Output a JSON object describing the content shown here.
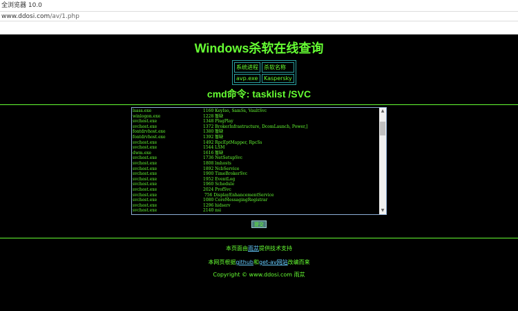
{
  "browser": {
    "title": "全浏览器 10.0",
    "url_host": "www.ddosi.com",
    "url_path": "/av/1.php"
  },
  "page": {
    "title": "Windows杀软在线查询",
    "table_headers": [
      "系统进程",
      "杀软名称"
    ],
    "table_rows": [
      [
        "avp.exe",
        "Kaspersky"
      ]
    ],
    "cmd_label": "cmd命令: tasklist /SVC",
    "processes": [
      {
        "image": "lsass.exe",
        "pid": "1160",
        "svc": "KeyIso, SamSs, VaultSvc"
      },
      {
        "image": "winlogon.exe",
        "pid": "1228",
        "svc": "暂缺"
      },
      {
        "image": "svchost.exe",
        "pid": "1348",
        "svc": "PlugPlay"
      },
      {
        "image": "svchost.exe",
        "pid": "1372",
        "svc": "BrokerInfrastructure, DcomLaunch, Power,]"
      },
      {
        "image": "fontdrvhost.exe",
        "pid": "1380",
        "svc": "暂缺"
      },
      {
        "image": "fontdrvhost.exe",
        "pid": "1392",
        "svc": "暂缺"
      },
      {
        "image": "svchost.exe",
        "pid": "1492",
        "svc": "RpcEptMapper, RpcSs"
      },
      {
        "image": "svchost.exe",
        "pid": "1544",
        "svc": "LSM"
      },
      {
        "image": "dwm.exe",
        "pid": "1616",
        "svc": "暂缺"
      },
      {
        "image": "svchost.exe",
        "pid": "1736",
        "svc": "NetSetupSvc"
      },
      {
        "image": "svchost.exe",
        "pid": "1808",
        "svc": "lmhosts"
      },
      {
        "image": "svchost.exe",
        "pid": "1892",
        "svc": "NcbService"
      },
      {
        "image": "svchost.exe",
        "pid": "1900",
        "svc": "TimeBrokerSvc"
      },
      {
        "image": "svchost.exe",
        "pid": "1952",
        "svc": "EventLog"
      },
      {
        "image": "svchost.exe",
        "pid": "1960",
        "svc": "Schedule"
      },
      {
        "image": "svchost.exe",
        "pid": "2024",
        "svc": "ProfSvc"
      },
      {
        "image": "svchost.exe",
        "pid": "756",
        "svc": "DisplayEnhancementService"
      },
      {
        "image": "svchost.exe",
        "pid": "1080",
        "svc": "CoreMessagingRegistrar"
      },
      {
        "image": "svchost.exe",
        "pid": "1296",
        "svc": "hidserv"
      },
      {
        "image": "svchost.exe",
        "pid": "2140",
        "svc": "nsi"
      }
    ],
    "submit_label": "提交"
  },
  "footer": {
    "support_prefix": "本页面由",
    "support_link": "雨苁",
    "support_suffix": "提供技术支持",
    "based_prefix": "本网页根据",
    "based_link1": "github",
    "based_mid": "和",
    "based_link2": "get-av网站",
    "based_suffix": "改编而来",
    "copyright": "Copyright © www.ddosi.com 雨苁"
  },
  "colors": {
    "accent": "#66ff33",
    "background": "#000000",
    "link": "#66ccff"
  }
}
